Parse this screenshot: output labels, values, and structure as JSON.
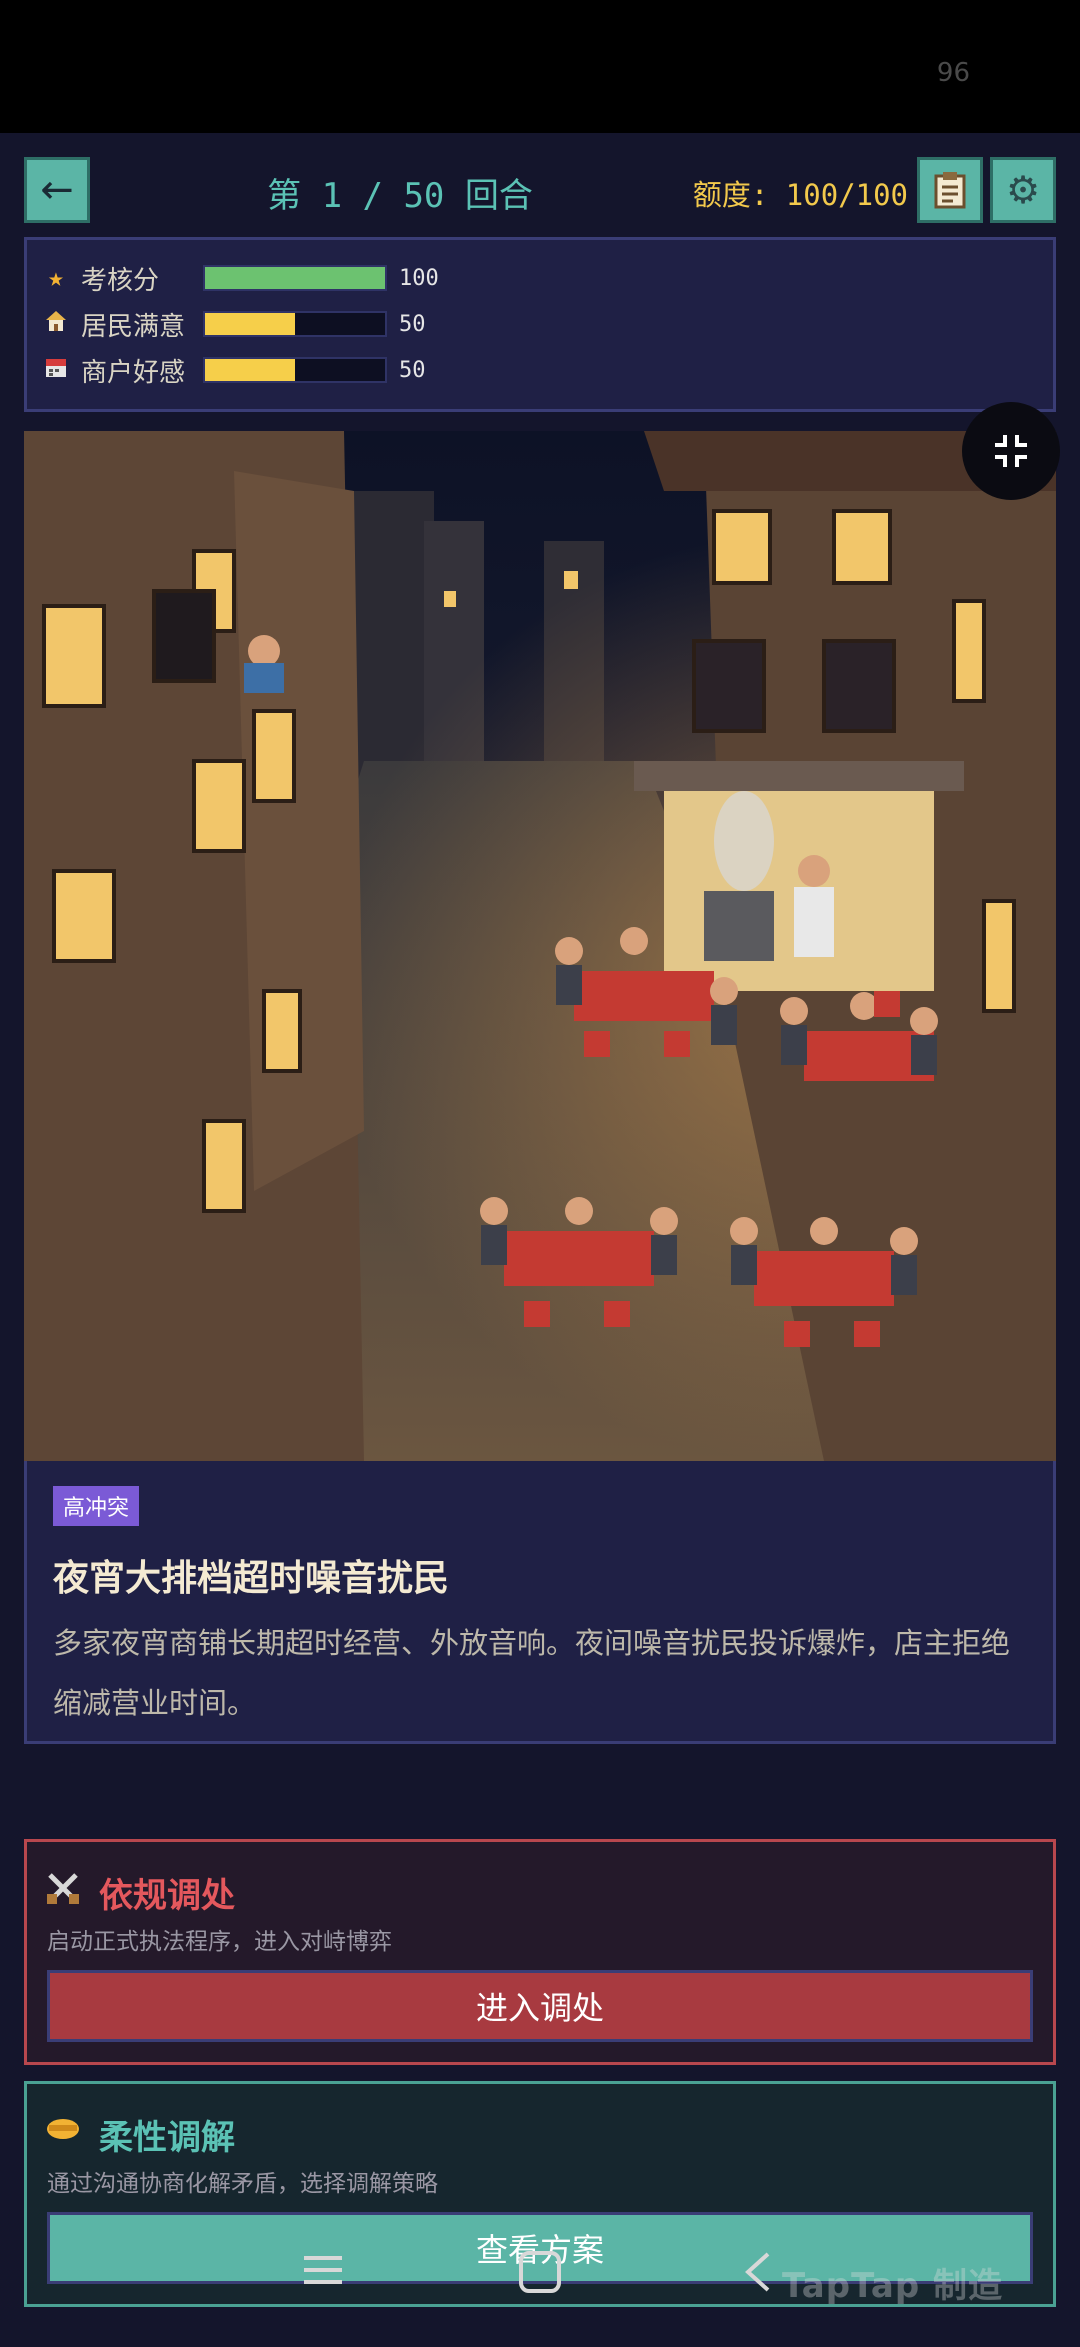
{
  "status_bar": {
    "indicator": "96"
  },
  "header": {
    "back_icon": "arrow-left-icon",
    "round_text": "第 1 / 50 回合",
    "quota_text": "额度: 100/100",
    "notes_icon": "clipboard-icon",
    "settings_icon": "gear-icon"
  },
  "stats": [
    {
      "icon": "star-icon",
      "glyph": "★",
      "label": "考核分",
      "value": 100,
      "value_text": "100",
      "max": 100,
      "color": "#6cc270"
    },
    {
      "icon": "house-icon",
      "glyph": "🏘",
      "label": "居民满意",
      "value": 50,
      "value_text": "50",
      "max": 100,
      "color": "#f6cf4a"
    },
    {
      "icon": "calendar-shop-icon",
      "glyph": "📅",
      "label": "商户好感",
      "value": 50,
      "value_text": "50",
      "max": 100,
      "color": "#f6cf4a"
    }
  ],
  "scene": {
    "icon": "exit-fullscreen-icon"
  },
  "event": {
    "tag": "高冲突",
    "title": "夜宵大排档超时噪音扰民",
    "description": "多家夜宵商铺长期超时经营、外放音响。夜间噪音扰民投诉爆炸，店主拒绝缩减营业时间。"
  },
  "options": {
    "legal": {
      "icon": "crossed-swords-icon",
      "title": "依规调处",
      "description": "启动正式执法程序，进入对峙博弈",
      "button": "进入调处"
    },
    "soft": {
      "icon": "handshake-icon",
      "title": "柔性调解",
      "description": "通过沟通协商化解矛盾，选择调解策略",
      "button": "查看方案"
    }
  },
  "nav": {
    "menu_icon": "menu-icon",
    "home_icon": "home-square-icon",
    "back_icon": "chevron-left-icon",
    "watermark": "TapTap 制造"
  }
}
